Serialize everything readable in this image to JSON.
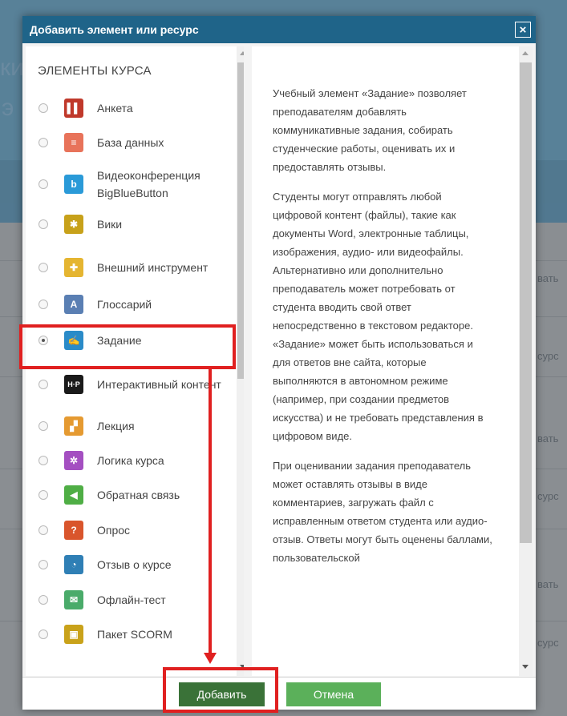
{
  "dialog": {
    "title": "Добавить элемент или ресурс",
    "close_glyph": "×"
  },
  "list": {
    "heading": "ЭЛЕМЕНТЫ КУРСА",
    "items": [
      {
        "label": "Анкета",
        "icon": "survey-icon",
        "color": "#c0392b",
        "glyph": "▌▌",
        "selected": false
      },
      {
        "label": "База данных",
        "icon": "database-icon",
        "color": "#e8735a",
        "glyph": "≡",
        "selected": false
      },
      {
        "label": "Видеоконференция BigBlueButton",
        "icon": "bigbluebutton-icon",
        "color": "#2a9ad8",
        "glyph": "b",
        "selected": false
      },
      {
        "label": "Вики",
        "icon": "wiki-icon",
        "color": "#c7a11a",
        "glyph": "✱",
        "selected": false
      },
      {
        "label": "Внешний инструмент",
        "icon": "puzzle-icon",
        "color": "#e5b531",
        "glyph": "✚",
        "selected": false
      },
      {
        "label": "Глоссарий",
        "icon": "glossary-icon",
        "color": "#5a7fb3",
        "glyph": "A",
        "selected": false
      },
      {
        "label": "Задание",
        "icon": "assignment-icon",
        "color": "#2a8bc8",
        "glyph": "✍",
        "selected": true
      },
      {
        "label": "Интерактивный контент",
        "icon": "h5p-icon",
        "color": "#1a1a1a",
        "glyph": "H·P",
        "selected": false
      },
      {
        "label": "Лекция",
        "icon": "lesson-icon",
        "color": "#e59a31",
        "glyph": "▞",
        "selected": false
      },
      {
        "label": "Логика курса",
        "icon": "gear-icon",
        "color": "#a44fc1",
        "glyph": "✲",
        "selected": false
      },
      {
        "label": "Обратная связь",
        "icon": "megaphone-icon",
        "color": "#4fae45",
        "glyph": "◀",
        "selected": false
      },
      {
        "label": "Опрос",
        "icon": "question-icon",
        "color": "#d9552c",
        "glyph": "?",
        "selected": false
      },
      {
        "label": "Отзыв о курсе",
        "icon": "chat-bubble-icon",
        "color": "#2f7fb5",
        "glyph": "◔",
        "selected": false
      },
      {
        "label": "Офлайн-тест",
        "icon": "envelope-icon",
        "color": "#4aab6a",
        "glyph": "✉",
        "selected": false
      },
      {
        "label": "Пакет SCORM",
        "icon": "scorm-icon",
        "color": "#c9a21a",
        "glyph": "▣",
        "selected": false
      }
    ]
  },
  "description": [
    "Учебный элемент «Задание» позволяет преподавателям добавлять коммуникативные задания, собирать студенческие работы, оценивать их и предоставлять отзывы.",
    "Студенты могут отправлять любой цифровой контент (файлы), такие как документы Word, электронные таблицы, изображения, аудио- или видеофайлы. Альтернативно или дополнительно преподаватель может потребовать от студента вводить свой ответ непосредственно в текстовом редакторе. «Задание» может быть использоваться и для ответов вне сайта, которые выполняются в автономном режиме (например, при создании предметов искусства) и не требовать представления в цифровом виде.",
    "При оценивании задания преподаватель может оставлять отзывы в виде комментариев, загружать файл с исправленным ответом студента или аудио-отзыв. Ответы могут быть оценены баллами, пользовательской"
  ],
  "footer": {
    "add_label": "Добавить",
    "cancel_label": "Отмена"
  },
  "background": {
    "fragments": [
      "ки",
      "э",
      "вать",
      "сурс",
      "вать",
      "сурс",
      "вать",
      "сурс"
    ]
  },
  "colors": {
    "header": "#1f6489",
    "add_button": "#3a7238",
    "cancel_button": "#5bb05a",
    "annotation": "#e02020"
  }
}
